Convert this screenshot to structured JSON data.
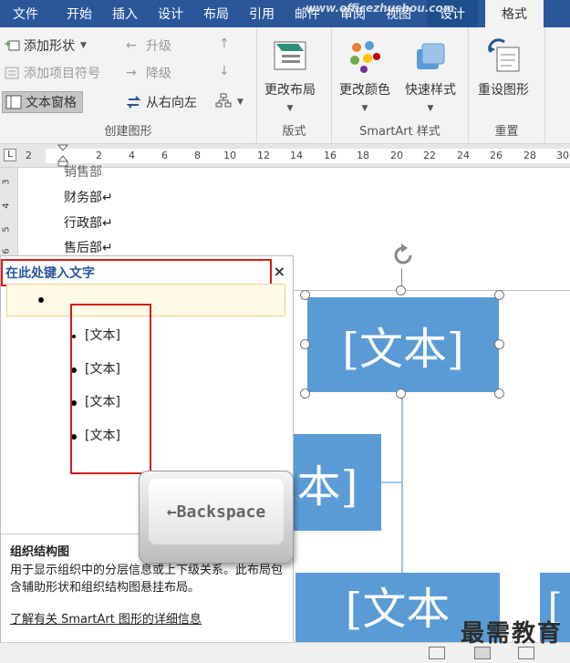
{
  "tabs": [
    "文件",
    "开始",
    "插入",
    "设计",
    "布局",
    "引用",
    "邮件",
    "审阅",
    "视图",
    "设计",
    "格式"
  ],
  "watermark_url": "www.officezhushou.com",
  "ribbon": {
    "create_graphic": {
      "add_shape": "添加形状",
      "add_bullet": "添加项目符号",
      "text_pane": "文本窗格",
      "promote": "升级",
      "demote": "降级",
      "right_to_left": "从右向左",
      "label": "创建图形"
    },
    "layouts": {
      "change_layout": "更改布局",
      "label": "版式"
    },
    "styles": {
      "change_colors": "更改颜色",
      "quick_styles": "快速样式",
      "label": "SmartArt 样式"
    },
    "reset": {
      "reset_graphic": "重设图形",
      "label": "重置"
    }
  },
  "ruler": {
    "ticks": [
      "2",
      "2",
      "4",
      "6",
      "8",
      "10",
      "12",
      "14",
      "16",
      "18",
      "20",
      "22",
      "24",
      "26",
      "28",
      "30"
    ],
    "vertical": [
      "3",
      "4",
      "5",
      "6"
    ]
  },
  "document": {
    "lines": [
      "财务部↵",
      "行政部↵",
      "售后部↵"
    ],
    "top_cut": "销售部"
  },
  "text_pane": {
    "title": "在此处键入文字",
    "close": "×",
    "items": [
      "[文本]",
      "[文本]",
      "[文本]",
      "[文本]"
    ],
    "desc_title": "组织结构图",
    "desc_body": "用于显示组织中的分层信息或上下级关系。此布局包含辅助形状和组织结构图悬挂布局。",
    "desc_link": "了解有关 SmartArt 图形的详细信息"
  },
  "smartart": {
    "top_box": "[文本]",
    "left_box": "本]",
    "bottom_box": "[文本",
    "bottom_right": "["
  },
  "overlay": {
    "key_label": "←Backspace"
  },
  "watermark": "最需教育",
  "colors": {
    "ribbon_blue": "#2b579a",
    "smartart_blue": "#5b9bd5",
    "highlight_red": "#d71a1a"
  }
}
